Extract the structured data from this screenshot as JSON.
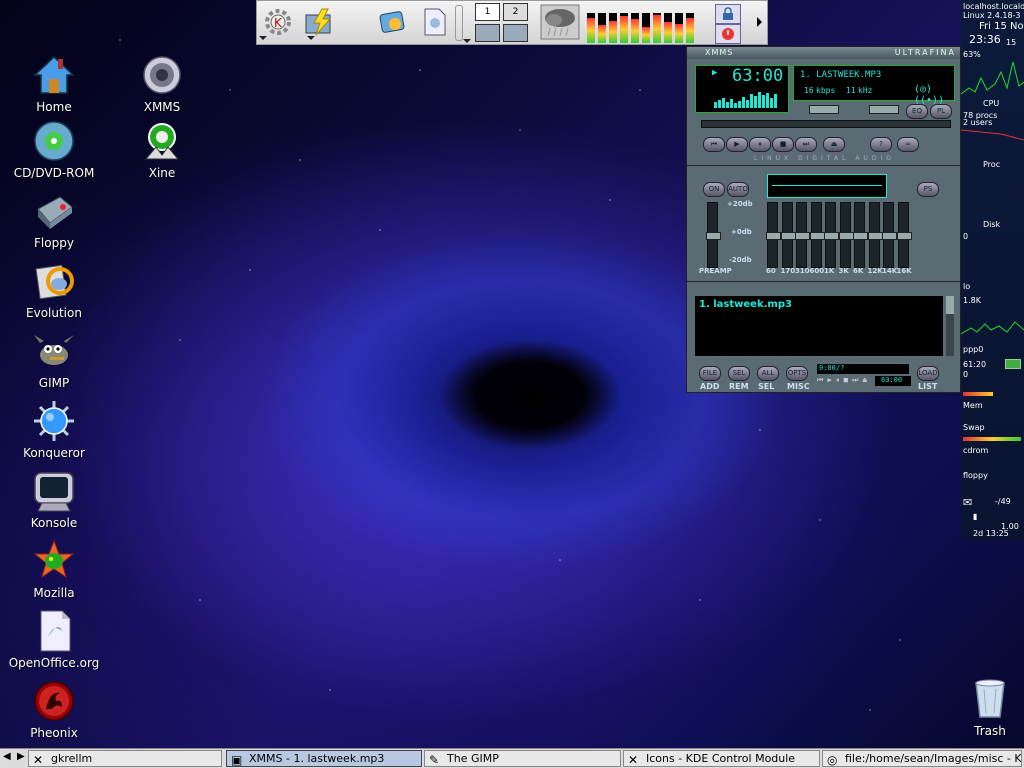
{
  "desktop": {
    "icons": [
      {
        "label": "Home",
        "icon": "home-icon"
      },
      {
        "label": "CD/DVD-ROM",
        "icon": "cdrom-icon"
      },
      {
        "label": "Floppy",
        "icon": "floppy-icon"
      },
      {
        "label": "Evolution",
        "icon": "evolution-icon"
      },
      {
        "label": "GIMP",
        "icon": "gimp-icon"
      },
      {
        "label": "Konqueror",
        "icon": "konqueror-icon"
      },
      {
        "label": "Konsole",
        "icon": "konsole-icon"
      },
      {
        "label": "Mozilla",
        "icon": "mozilla-icon"
      },
      {
        "label": "OpenOffice.org",
        "icon": "openoffice-icon"
      },
      {
        "label": "Pheonix",
        "icon": "phoenix-icon"
      },
      {
        "label": "XMMS",
        "icon": "speaker-icon"
      },
      {
        "label": "Xine",
        "icon": "xine-icon"
      },
      {
        "label": "Trash",
        "icon": "trash-icon"
      }
    ]
  },
  "panel": {
    "pager": [
      "1",
      "2"
    ],
    "meter_levels": [
      0.85,
      0.6,
      0.75,
      0.9,
      0.8,
      0.55,
      0.95,
      0.7,
      0.65,
      0.85
    ]
  },
  "xmms": {
    "title": "XMMS",
    "skin": "ULTRAFINA",
    "time": "63:00",
    "track": "1. LASTWEEK.MP3",
    "kbps": "16",
    "khz": "11",
    "kbps_unit": "kbps",
    "khz_unit": "kHz",
    "brand": "LINUX DIGITAL AUDIO",
    "eq_on": "ON",
    "eq_auto": "AUTO",
    "eq_presets": "PS",
    "eq_db_top": "+20db",
    "eq_db_mid": "+0db",
    "eq_db_bot": "-20db",
    "preamp": "PREAMP",
    "eq_bands": [
      "60",
      "170",
      "310",
      "600",
      "1K",
      "3K",
      "6K",
      "12K",
      "14K",
      "16K"
    ],
    "btn_eq": "EQ",
    "btn_pl": "PL",
    "playlist_item": "1. lastweek.mp3",
    "pl_time": "0:00/?",
    "pl_total": "63:00",
    "pl_buttons": [
      {
        "top": "FILE",
        "bottom": "ADD"
      },
      {
        "top": "SEL",
        "bottom": "REM"
      },
      {
        "top": "ALL",
        "bottom": "SEL"
      },
      {
        "top": "OPTS",
        "bottom": "MISC"
      },
      {
        "top": "LOAD",
        "bottom": "LIST"
      }
    ]
  },
  "gkrellm": {
    "host": "localhost.locald",
    "kernel": "Linux 2.4.18-3",
    "date": "Fri 15 Nov",
    "time": "23:36",
    "seconds": "15",
    "cpu_pct": "63%",
    "cpu_label": "CPU",
    "procs": "78 procs",
    "users": "2 users",
    "proc_label": "Proc",
    "disk_label": "Disk",
    "disk_val": "0",
    "lo_label": "lo",
    "lo_rate": "1.8K",
    "ppp_label": "ppp0",
    "ppp_time": "61:20",
    "ppp_val": "0",
    "mem_label": "Mem",
    "swap_label": "Swap",
    "cdrom_label": "cdrom",
    "floppy_label": "floppy",
    "mail_count": "-/49",
    "load": "1.00",
    "uptime": "2d 13:25"
  },
  "taskbar": {
    "tasks": [
      {
        "label": "gkrellm",
        "icon": "x-icon"
      },
      {
        "label": "XMMS - 1. lastweek.mp3",
        "icon": "xmms-icon"
      },
      {
        "label": "The GIMP",
        "icon": "gimp-icon"
      },
      {
        "label": "Icons - KDE Control Module",
        "icon": "x-icon"
      },
      {
        "label": "file:/home/sean/Images/misc - Konque",
        "icon": "konqueror-icon"
      }
    ]
  }
}
